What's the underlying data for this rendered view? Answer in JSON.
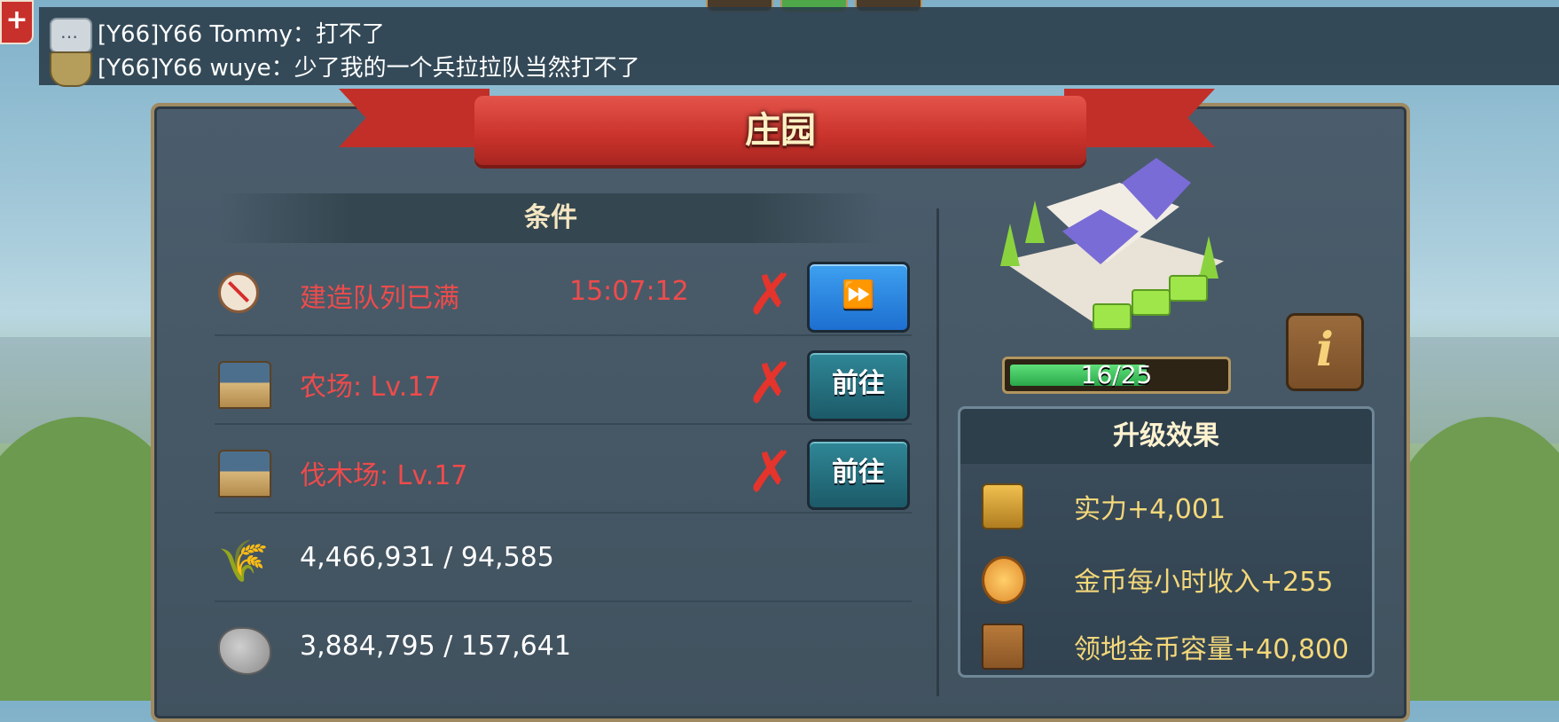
{
  "chat": {
    "line1": "[Y66]Y66 Tommy：打不了",
    "line2": "[Y66]Y66 wuye：少了我的一个兵拉拉队当然打不了"
  },
  "panel": {
    "title": "庄园",
    "conditions_header": "条件"
  },
  "conditions": [
    {
      "label": "建造队列已满",
      "timer": "15:07:12",
      "status": "unmet",
      "icon": "no-build-icon",
      "button": "⏩"
    },
    {
      "label": "农场: Lv.17",
      "status": "unmet",
      "icon": "farm-house-icon",
      "button": "前往"
    },
    {
      "label": "伐木场: Lv.17",
      "status": "unmet",
      "icon": "lumber-mill-icon",
      "button": "前往"
    }
  ],
  "resources": [
    {
      "icon": "wheat-icon",
      "text": "4,466,931 / 94,585"
    },
    {
      "icon": "stone-icon",
      "text": "3,884,795 / 157,641"
    }
  ],
  "building": {
    "level_progress_text": "16/25",
    "level_current": 16,
    "level_max": 25,
    "info_label": "i"
  },
  "effects": {
    "header": "升级效果",
    "items": [
      {
        "icon": "power-fist-icon",
        "text": "实力+4,001"
      },
      {
        "icon": "gold-coin-icon",
        "text": "金币每小时收入+255"
      },
      {
        "icon": "crate-icon",
        "text": "领地金币容量+40,800"
      }
    ]
  },
  "colors": {
    "ribbon_red": "#c8322b",
    "unmet_red": "#ef4b4b",
    "effect_gold": "#f4d87a",
    "progress_green": "#2aa84a"
  }
}
